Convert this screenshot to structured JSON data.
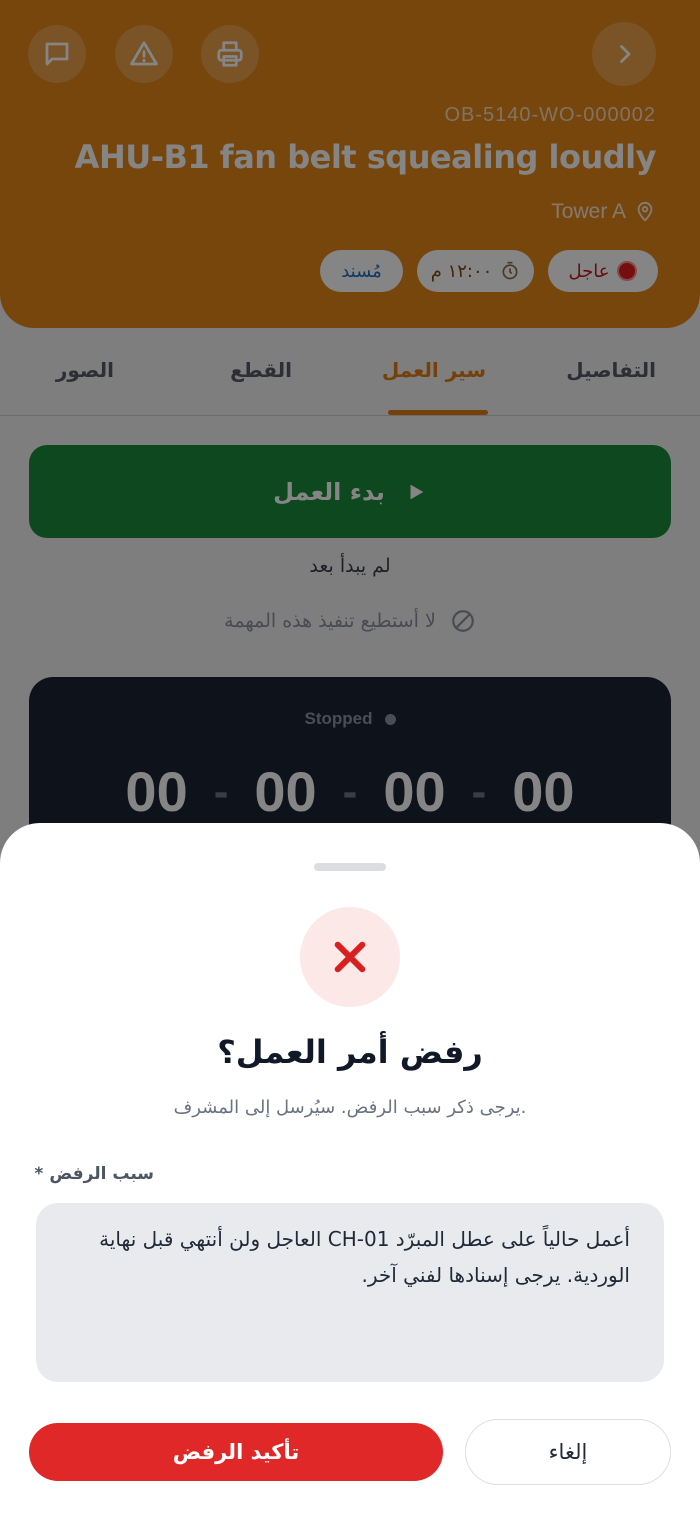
{
  "header": {
    "work_order_number": "OB-5140-WO-000002",
    "title": "AHU-B1 fan belt squealing loudly",
    "location": "Tower A",
    "chips": {
      "priority": "عاجل",
      "time": "١٢:٠٠ م",
      "status": "مُسند"
    },
    "accent_color": "#e4861a"
  },
  "tabs": [
    {
      "label": "التفاصيل"
    },
    {
      "label": "سير العمل"
    },
    {
      "label": "القطع"
    },
    {
      "label": "الصور"
    }
  ],
  "active_tab": "سير العمل",
  "workflow": {
    "start_label": "بدء العمل",
    "status_text": "لم يبدأ بعد",
    "cant_do_label": "لا أستطيع تنفيذ هذه المهمة",
    "timer": {
      "status": "Stopped",
      "segments": [
        "00",
        "00",
        "00",
        "00"
      ]
    }
  },
  "reject_sheet": {
    "title": "رفض أمر العمل؟",
    "subtitle": "يرجى ذكر سبب الرفض. سيُرسل إلى المشرف.",
    "reason_label": "سبب الرفض",
    "required_mark": "*",
    "reason_value": "أعمل حالياً على عطل المبرّد CH-01 العاجل ولن أنتهي قبل نهاية الوردية. يرجى إسنادها لفني آخر.",
    "confirm_label": "تأكيد الرفض",
    "cancel_label": "إلغاء"
  },
  "icons": {
    "back": "chevron-right-icon",
    "print": "printer-icon",
    "warning": "warning-icon",
    "message": "message-icon",
    "location": "map-pin-icon",
    "timer": "stopwatch-icon",
    "play": "play-icon",
    "blocked": "block-icon",
    "reject": "close-icon"
  }
}
